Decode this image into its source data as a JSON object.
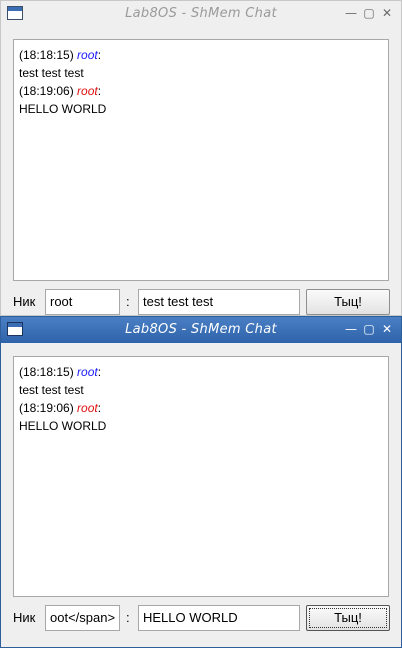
{
  "window1": {
    "title": "Lab8OS - ShMem Chat",
    "messages": [
      {
        "time": "(18:18:15)",
        "nick": "root",
        "nick_color": "#1a1aff",
        "text": "test test test"
      },
      {
        "time": "(18:19:06)",
        "nick": "root",
        "nick_color": "#e01010",
        "text": "HELLO WORLD"
      }
    ],
    "nick_label": "Ник",
    "nick_value": "root",
    "separator": ":",
    "message_value": "test test test",
    "send_label": "Тыц!"
  },
  "window2": {
    "title": "Lab8OS - ShMem Chat",
    "messages": [
      {
        "time": "(18:18:15)",
        "nick": "root",
        "nick_color": "#1a1aff",
        "text": "test test test"
      },
      {
        "time": "(18:19:06)",
        "nick": "root",
        "nick_color": "#e01010",
        "text": "HELLO WORLD"
      }
    ],
    "nick_label": "Ник",
    "nick_value": "oot</span>",
    "separator": ":",
    "message_value": "HELLO WORLD",
    "send_label": "Тыц!"
  },
  "icons": {
    "app": "app-window-icon",
    "minimize": "minimize-icon",
    "maximize": "maximize-icon",
    "close": "close-icon"
  },
  "colors": {
    "active_titlebar": "#2e63ab",
    "nick_blue": "#1a1aff",
    "nick_red": "#e01010"
  }
}
